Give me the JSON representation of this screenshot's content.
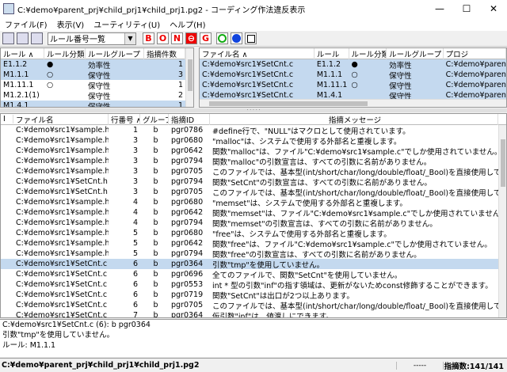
{
  "window": {
    "title": "C:¥demo¥parent_prj¥child_prj1¥child_prj1.pg2 - コーディング作法違反表示",
    "minimize": "—",
    "maximize": "☐",
    "close": "✕"
  },
  "menu": [
    "ファイル(F)",
    "表示(V)",
    "ユーティリティ(U)",
    "ヘルプ(H)"
  ],
  "toolbar": {
    "view_select": "ルール番号一覧",
    "letters": [
      "B",
      "O",
      "N",
      "G"
    ],
    "no_entry": "⊖"
  },
  "rule_table": {
    "headers": [
      "ルール ∧",
      "ルール分類",
      "ルールグループ",
      "指摘件数"
    ],
    "rows": [
      {
        "rule": "E1.1.2",
        "class": "●",
        "group": "効率性",
        "count": "1",
        "selected": true
      },
      {
        "rule": "M1.1.1",
        "class": "○",
        "group": "保守性",
        "count": "3",
        "selected": true
      },
      {
        "rule": "M1.11.1",
        "class": "○",
        "group": "保守性",
        "count": "1",
        "selected": false
      },
      {
        "rule": "M1.2.1(1)",
        "class": "",
        "group": "保守性",
        "count": "2",
        "selected": false
      },
      {
        "rule": "M1.4.1",
        "class": "",
        "group": "保守性",
        "count": "1",
        "selected": true
      }
    ]
  },
  "file_table": {
    "headers": [
      "ファイル名 ∧",
      "ルール",
      "ルール分類",
      "ルールグループ",
      "プロジ"
    ],
    "rows": [
      {
        "file": "C:¥demo¥src1¥SetCnt.c",
        "rule": "E1.1.2",
        "class": "●",
        "group": "効率性",
        "proj": "C:¥demo¥parent_"
      },
      {
        "file": "C:¥demo¥src1¥SetCnt.c",
        "rule": "M1.1.1",
        "class": "○",
        "group": "保守性",
        "proj": "C:¥demo¥parent_"
      },
      {
        "file": "C:¥demo¥src1¥SetCnt.c",
        "rule": "M1.11.1",
        "class": "○",
        "group": "保守性",
        "proj": "C:¥demo¥parent_"
      },
      {
        "file": "C:¥demo¥src1¥SetCnt.c",
        "rule": "M1.4.1",
        "class": "",
        "group": "保守性",
        "proj": "C:¥demo¥parent_"
      }
    ]
  },
  "msg_table": {
    "headers": [
      "I",
      "ファイル名",
      "行番号 ∧",
      "グループ",
      "指摘ID",
      "指摘メッセージ"
    ],
    "rows": [
      {
        "file": "C:¥demo¥src1¥sample.h",
        "line": "1",
        "grp": "b",
        "id": "pgr0786",
        "msg": "#define行で、\"NULL\"はマクロとして使用されています。"
      },
      {
        "file": "C:¥demo¥src1¥sample.h",
        "line": "3",
        "grp": "b",
        "id": "pgr0680",
        "msg": "\"malloc\"は、システムで使用する外部名と重複します。"
      },
      {
        "file": "C:¥demo¥src1¥sample.h",
        "line": "3",
        "grp": "b",
        "id": "pgr0642",
        "msg": "関数\"malloc\"は、ファイル\"C:¥demo¥src1¥sample.c\"でしか使用されていません。"
      },
      {
        "file": "C:¥demo¥src1¥sample.h",
        "line": "3",
        "grp": "b",
        "id": "pgr0794",
        "msg": "関数\"malloc\"の引数宣言は、すべての引数に名前がありません。"
      },
      {
        "file": "C:¥demo¥src1¥sample.h",
        "line": "3",
        "grp": "b",
        "id": "pgr0705",
        "msg": "このファイルでは、基本型(int/short/char/long/double/float/_Bool)を直接使用しています"
      },
      {
        "file": "C:¥demo¥src1¥SetCnt.h",
        "line": "3",
        "grp": "b",
        "id": "pgr0794",
        "msg": "関数\"SetCnt\"の引数宣言は、すべての引数に名前がありません。"
      },
      {
        "file": "C:¥demo¥src1¥SetCnt.h",
        "line": "3",
        "grp": "b",
        "id": "pgr0705",
        "msg": "このファイルでは、基本型(int/short/char/long/double/float/_Bool)を直接使用しています"
      },
      {
        "file": "C:¥demo¥src1¥sample.h",
        "line": "4",
        "grp": "b",
        "id": "pgr0680",
        "msg": "\"memset\"は、システムで使用する外部名と重複します。"
      },
      {
        "file": "C:¥demo¥src1¥sample.h",
        "line": "4",
        "grp": "b",
        "id": "pgr0642",
        "msg": "関数\"memset\"は、ファイル\"C:¥demo¥src1¥sample.c\"でしか使用されていません。"
      },
      {
        "file": "C:¥demo¥src1¥sample.h",
        "line": "4",
        "grp": "b",
        "id": "pgr0794",
        "msg": "関数\"memset\"の引数宣言は、すべての引数に名前がありません。"
      },
      {
        "file": "C:¥demo¥src1¥sample.h",
        "line": "5",
        "grp": "b",
        "id": "pgr0680",
        "msg": "\"free\"は、システムで使用する外部名と重複します。"
      },
      {
        "file": "C:¥demo¥src1¥sample.h",
        "line": "5",
        "grp": "b",
        "id": "pgr0642",
        "msg": "関数\"free\"は、ファイル\"C:¥demo¥src1¥sample.c\"でしか使用されていません。"
      },
      {
        "file": "C:¥demo¥src1¥sample.h",
        "line": "5",
        "grp": "b",
        "id": "pgr0794",
        "msg": "関数\"free\"の引数宣言は、すべての引数に名前がありません。"
      },
      {
        "file": "C:¥demo¥src1¥SetCnt.c",
        "line": "6",
        "grp": "b",
        "id": "pgr0364",
        "msg": "引数\"tmp\"を使用していません。",
        "selected": true
      },
      {
        "file": "C:¥demo¥src1¥SetCnt.c",
        "line": "6",
        "grp": "b",
        "id": "pgr0696",
        "msg": "全てのファイルで、関数\"SetCnt\"を使用していません。"
      },
      {
        "file": "C:¥demo¥src1¥SetCnt.c",
        "line": "6",
        "grp": "b",
        "id": "pgr0553",
        "msg": "int * 型の引数\"inf\"の指す領域は、更新がないためconst修飾することができます。"
      },
      {
        "file": "C:¥demo¥src1¥SetCnt.c",
        "line": "6",
        "grp": "b",
        "id": "pgr0719",
        "msg": "関数\"SetCnt\"は出口が2つ以上あります。"
      },
      {
        "file": "C:¥demo¥src1¥SetCnt.c",
        "line": "6",
        "grp": "b",
        "id": "pgr0705",
        "msg": "このファイルでは、基本型(int/short/char/long/double/float/_Bool)を直接使用しています"
      },
      {
        "file": "C:¥demo¥src1¥SetCnt.c",
        "line": "7",
        "grp": "b",
        "id": "pgr0364",
        "msg": "仮引数\"inf\"は、値渡しにできます。"
      },
      {
        "file": "C:¥demo¥src1¥SetCnt.c",
        "line": "8",
        "grp": "b",
        "id": "pgr1395",
        "msg": "リテラル10を使用しています。(リテラルの種類 INTEGER)"
      }
    ]
  },
  "detail": {
    "lines": [
      "C:¥demo¥src1¥SetCnt.c (6): b pgr0364",
      "引数\"tmp\"を使用していません。",
      "ルール: M1.1.1"
    ]
  },
  "status": {
    "path": "C:¥demo¥parent_prj¥child_prj1¥child_prj1.pg2",
    "dash": "-----",
    "count": "指摘数:141/141"
  },
  "colors": {
    "selection": "#c4d9ef",
    "accent_red": "#e00000"
  }
}
